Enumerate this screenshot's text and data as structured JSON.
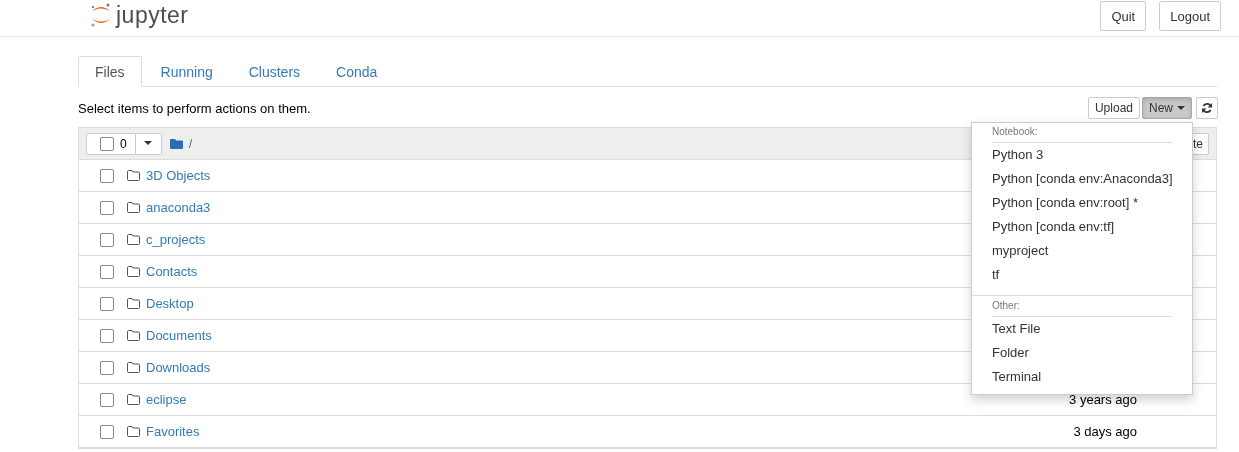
{
  "header": {
    "logo_text": "jupyter",
    "buttons": [
      "Quit",
      "Logout"
    ]
  },
  "tabs": [
    {
      "label": "Files",
      "selected": true
    },
    {
      "label": "Running",
      "selected": false
    },
    {
      "label": "Clusters",
      "selected": false
    },
    {
      "label": "Conda",
      "selected": false
    }
  ],
  "toolbar": {
    "hint": "Select items to perform actions on them.",
    "upload": "Upload",
    "new_button": {
      "label": "New",
      "expanded": true
    }
  },
  "list_header": {
    "selected_count": "0",
    "all_checked": false,
    "path": "/",
    "hidden_button": "te"
  },
  "files": [
    {
      "name": "3D Objects",
      "checked": false
    },
    {
      "name": "anaconda3",
      "checked": false
    },
    {
      "name": "c_projects",
      "checked": false
    },
    {
      "name": "Contacts",
      "checked": false
    },
    {
      "name": "Desktop",
      "checked": false
    },
    {
      "name": "Documents",
      "checked": false
    },
    {
      "name": "Downloads",
      "checked": false
    },
    {
      "name": "eclipse",
      "checked": false,
      "modified": "3 years ago"
    },
    {
      "name": "Favorites",
      "checked": false,
      "modified": "3 days ago"
    }
  ],
  "new_menu": {
    "sections": [
      {
        "header": "Notebook:",
        "items": [
          "Python 3",
          "Python [conda env:Anaconda3]",
          "Python [conda env:root] *",
          "Python [conda env:tf]",
          "myproject",
          "tf"
        ]
      },
      {
        "header": "Other:",
        "items": [
          "Text File",
          "Folder",
          "Terminal"
        ]
      }
    ]
  }
}
